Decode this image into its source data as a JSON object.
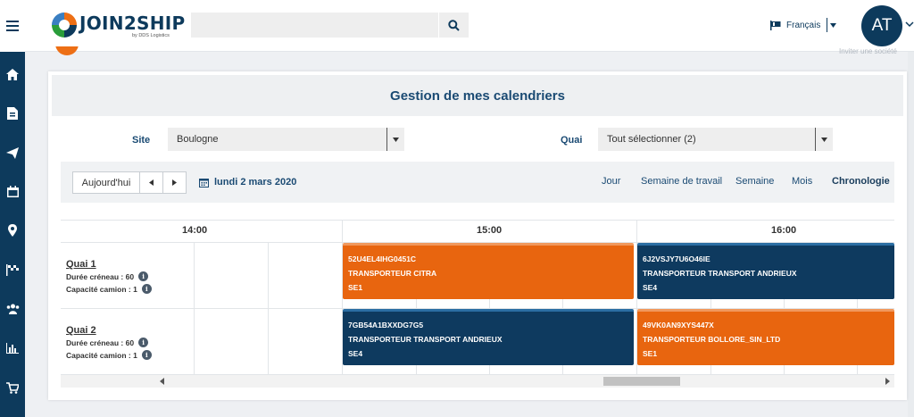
{
  "header": {
    "brand": "JOIN2SHIP",
    "tagline": "by DDS Logistics",
    "search_placeholder": "",
    "language": "Français",
    "avatar_initials": "AT"
  },
  "sidebar": {
    "items": [
      "menu-icon",
      "home-icon",
      "document-icon",
      "send-icon",
      "calendar-icon",
      "location-icon",
      "flag-icon",
      "users-icon",
      "chart-icon",
      "cart-icon"
    ]
  },
  "page": {
    "title": "Gestion de mes calendriers",
    "site_label": "Site",
    "site_value": "Boulogne",
    "quai_label": "Quai",
    "quai_value": "Tout sélectionner (2)"
  },
  "scheduler": {
    "today_label": "Aujourd'hui",
    "current_date": "lundi 2 mars 2020",
    "views": [
      "Jour",
      "Semaine de travail",
      "Semaine",
      "Mois",
      "Chronologie"
    ],
    "active_view": "Chronologie",
    "times": [
      "14:00",
      "15:00",
      "16:00"
    ],
    "resources": [
      {
        "name": "Quai 1",
        "duree": "Durée créneau : 60",
        "capacite": "Capacité camion : 1"
      },
      {
        "name": "Quai 2",
        "duree": "Durée créneau : 60",
        "capacite": "Capacité camion : 1"
      }
    ],
    "events": [
      {
        "id": "52U4EL4IHG0451C",
        "carrier": "TRANSPORTEUR CITRA",
        "code": "SE1",
        "color": "#e8650f"
      },
      {
        "id": "6J2VSJY7U6O46IE",
        "carrier": "TRANSPORTEUR TRANSPORT ANDRIEUX",
        "code": "SE4",
        "color": "#0e3a5f"
      },
      {
        "id": "7GB54A1BXXDG7G5",
        "carrier": "TRANSPORTEUR TRANSPORT ANDRIEUX",
        "code": "SE4",
        "color": "#0e3a5f"
      },
      {
        "id": "49VK0AN9XYS447X",
        "carrier": "TRANSPORTEUR BOLLORE_SIN_LTD",
        "code": "SE1",
        "color": "#e8650f"
      }
    ]
  },
  "colors": {
    "primary": "#0d3a5c",
    "accent": "#e8650f"
  }
}
